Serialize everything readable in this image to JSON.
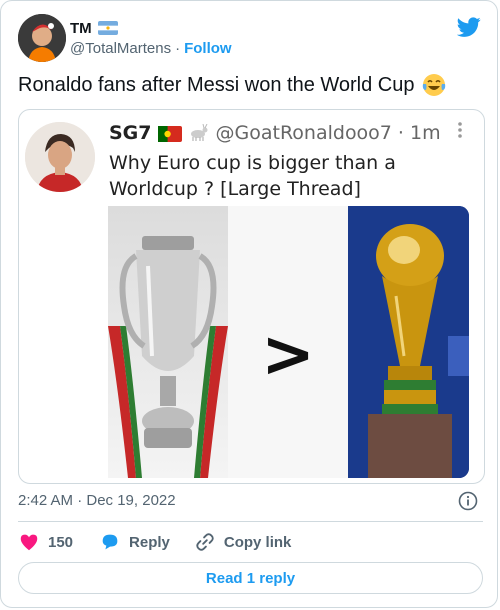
{
  "author": {
    "display_name": "TM",
    "handle": "@TotalMartens",
    "separator": "·",
    "follow_label": "Follow",
    "flag_icon": "argentina-flag-icon",
    "avatar_icon": "profile-avatar"
  },
  "brand": {
    "icon": "twitter-bird-icon",
    "color": "#1d9bf0"
  },
  "tweet": {
    "text": "Ronaldo fans after Messi won the World Cup",
    "emoji": "face-with-tears-of-joy-icon"
  },
  "quoted": {
    "name": "SG7",
    "handle": "@GoatRonaldooo7",
    "time": "· 1m",
    "text_line1": "Why Euro cup is bigger than a",
    "text_line2": "Worldcup ? [Large Thread]",
    "image_symbol": ">"
  },
  "meta": {
    "timestamp": "2:42 AM · Dec 19, 2022"
  },
  "actions": {
    "like_count": "150",
    "reply_label": "Reply",
    "copy_label": "Copy link",
    "like_color": "#f91880"
  },
  "read_replies_label": "Read 1 reply"
}
